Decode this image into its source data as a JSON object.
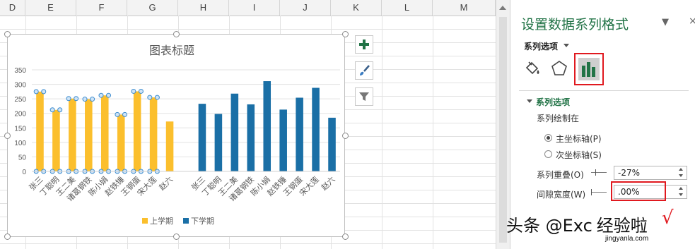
{
  "spreadsheet": {
    "columns": [
      "D",
      "E",
      "F",
      "G",
      "H",
      "I",
      "J",
      "K",
      "L",
      "M"
    ]
  },
  "chart_data": {
    "type": "bar",
    "title": "图表标题",
    "categories": [
      "张三",
      "丁聪明",
      "王二美",
      "诸葛钢铁",
      "陈小娟",
      "赵铁锤",
      "王钢蛋",
      "宋大莲",
      "赵六"
    ],
    "series": [
      {
        "name": "上学期",
        "color": "#fbbf2d",
        "values": [
          275,
          212,
          251,
          249,
          262,
          196,
          276,
          255,
          172
        ]
      },
      {
        "name": "下学期",
        "color": "#1a6fa6",
        "values": [
          233,
          198,
          268,
          231,
          311,
          213,
          254,
          288,
          185
        ]
      }
    ],
    "y_ticks": [
      "0",
      "50",
      "100",
      "150",
      "200",
      "250",
      "300",
      "350"
    ],
    "ylim": [
      0,
      350
    ],
    "legend_position": "bottom",
    "selected_series": "上学期",
    "grid": true
  },
  "chart_tools": {
    "add_element_icon": "plus-icon",
    "style_icon": "paintbrush-icon",
    "filter_icon": "funnel-icon"
  },
  "pane": {
    "title": "设置数据系列格式",
    "tab_label": "系列选项",
    "section_title": "系列选项",
    "plot_on_label": "系列绘制在",
    "primary_axis_label": "主坐标轴(P)",
    "secondary_axis_label": "次坐标轴(S)",
    "overlap_label": "系列重叠(O)",
    "overlap_value": "-27%",
    "gap_label": "间隙宽度(W)",
    "gap_value": ".00%",
    "selected_axis": "primary",
    "accent_color": "#217346",
    "highlight_color": "#e0191f"
  },
  "watermark": {
    "text": "头条 @Exc",
    "brand": "经验啦",
    "check": "√",
    "url": "jingyanla.com"
  }
}
